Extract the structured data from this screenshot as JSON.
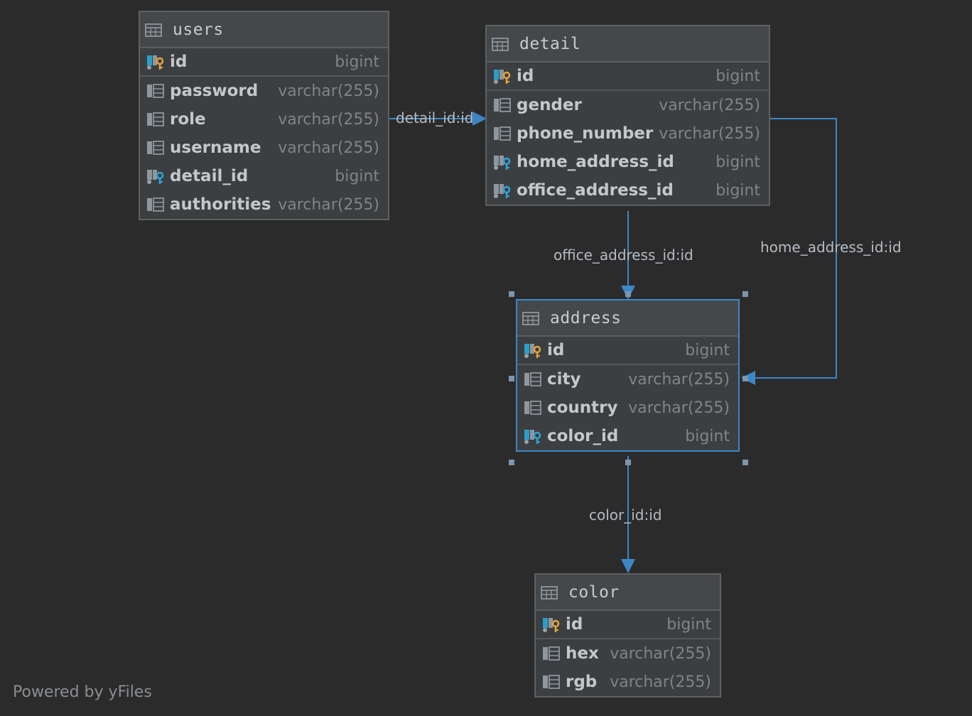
{
  "tables": {
    "users": {
      "name": "users",
      "pk": {
        "name": "id",
        "type": "bigint"
      },
      "columns": [
        {
          "name": "password",
          "type": "varchar(255)",
          "icon": "column-icon"
        },
        {
          "name": "role",
          "type": "varchar(255)",
          "icon": "column-icon"
        },
        {
          "name": "username",
          "type": "varchar(255)",
          "icon": "column-icon"
        },
        {
          "name": "detail_id",
          "type": "bigint",
          "icon": "foreign-key-icon"
        },
        {
          "name": "authorities",
          "type": "varchar(255)",
          "icon": "column-icon"
        }
      ]
    },
    "detail": {
      "name": "detail",
      "pk": {
        "name": "id",
        "type": "bigint"
      },
      "columns": [
        {
          "name": "gender",
          "type": "varchar(255)",
          "icon": "column-icon"
        },
        {
          "name": "phone_number",
          "type": "varchar(255)",
          "icon": "column-icon"
        },
        {
          "name": "home_address_id",
          "type": "bigint",
          "icon": "foreign-key-icon"
        },
        {
          "name": "office_address_id",
          "type": "bigint",
          "icon": "foreign-key-icon"
        }
      ]
    },
    "address": {
      "name": "address",
      "pk": {
        "name": "id",
        "type": "bigint"
      },
      "columns": [
        {
          "name": "city",
          "type": "varchar(255)",
          "icon": "column-icon"
        },
        {
          "name": "country",
          "type": "varchar(255)",
          "icon": "column-icon"
        },
        {
          "name": "color_id",
          "type": "bigint",
          "icon": "foreign-key-icon"
        }
      ]
    },
    "color": {
      "name": "color",
      "pk": {
        "name": "id",
        "type": "bigint"
      },
      "columns": [
        {
          "name": "hex",
          "type": "varchar(255)",
          "icon": "column-icon"
        },
        {
          "name": "rgb",
          "type": "varchar(255)",
          "icon": "column-icon"
        }
      ]
    }
  },
  "relations": {
    "users_detail": "detail_id:id",
    "detail_address_office": "office_address_id:id",
    "detail_address_home": "home_address_id:id",
    "address_color": "color_id:id"
  },
  "footer": "Powered by yFiles",
  "colors": {
    "background": "#2b2b2b",
    "edge": "#3d86c6",
    "primary_key": "#e8a33a",
    "foreign_key": "#2fa5d8"
  }
}
